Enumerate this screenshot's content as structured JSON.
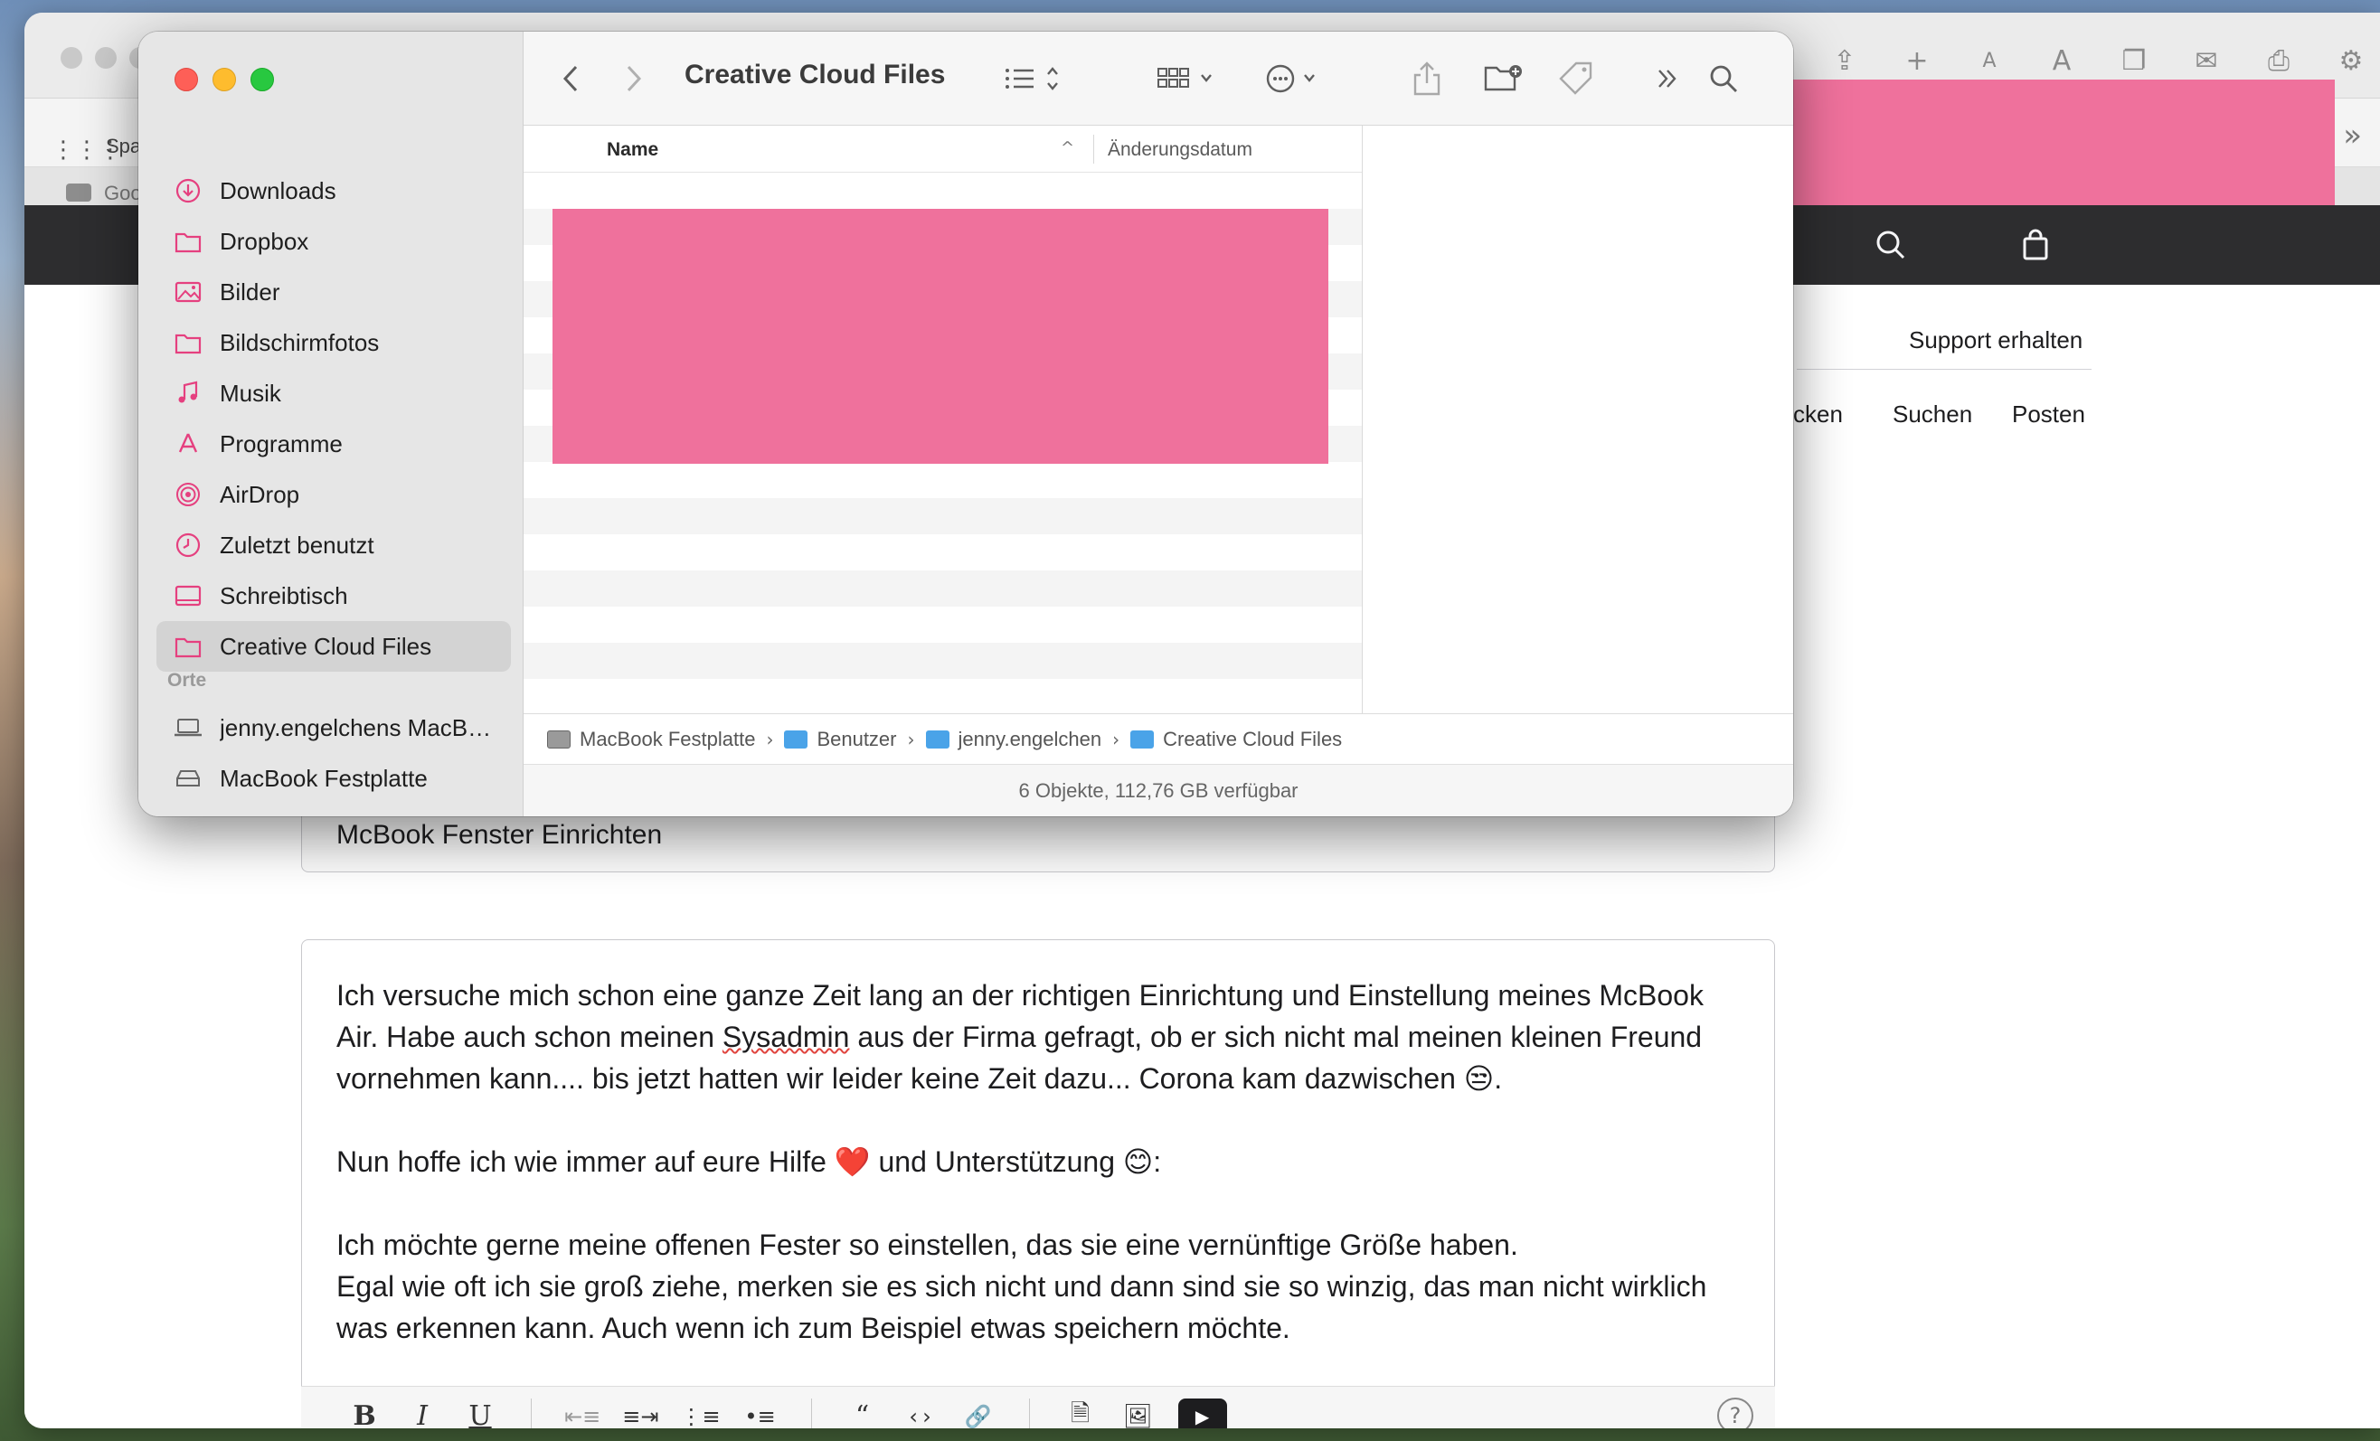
{
  "browser": {
    "favorites_label": "Spa",
    "tab_label": "Goo",
    "support_link": "Support erhalten",
    "sub_nav": [
      "cken",
      "Suchen",
      "Posten"
    ],
    "post_title": "McBook Fenster Einrichten",
    "post_body": {
      "p1": "Ich versuche mich schon eine ganze Zeit lang an der richtigen Einrichtung und Einstellung meines McBook Air. Habe auch schon meinen ",
      "p1_misspelled": "Sysadmin",
      "p1_rest": " aus der Firma gefragt, ob er sich nicht mal meinen kleinen Freund vornehmen kann.... bis jetzt hatten wir leider keine Zeit dazu... Corona kam dazwischen ",
      "p1_emoji": "😒",
      "p1_end": ".",
      "p2_a": "Nun hoffe ich wie immer auf eure Hilfe ",
      "p2_heart": "❤️",
      "p2_b": " und Unterstützung ",
      "p2_emoji": "😊",
      "p2_end": ":",
      "p3_line1": "Ich möchte gerne meine offenen Fester so einstellen, das sie eine vernünftige Größe haben.",
      "p3_line2": "Egal wie oft ich sie groß ziehe, merken sie es sich nicht und dann sind sie so winzig, das man nicht wirklich was erkennen kann. Auch wenn ich zum Beispiel etwas speichern möchte."
    },
    "editor_toolbar": [
      "B",
      "I",
      "U"
    ]
  },
  "finder": {
    "title": "Creative Cloud Files",
    "sidebar": {
      "favorites": [
        {
          "label": "Downloads",
          "icon": "download-icon"
        },
        {
          "label": "Dropbox",
          "icon": "folder-icon"
        },
        {
          "label": "Bilder",
          "icon": "photo-icon"
        },
        {
          "label": "Bildschirmfotos",
          "icon": "folder-icon"
        },
        {
          "label": "Musik",
          "icon": "music-icon"
        },
        {
          "label": "Programme",
          "icon": "apps-icon"
        },
        {
          "label": "AirDrop",
          "icon": "airdrop-icon"
        },
        {
          "label": "Zuletzt benutzt",
          "icon": "clock-icon"
        },
        {
          "label": "Schreibtisch",
          "icon": "desktop-icon"
        },
        {
          "label": "Creative Cloud Files",
          "icon": "folder-icon"
        }
      ],
      "locations_header": "Orte",
      "locations": [
        {
          "label": "jenny.engelchens MacBook Air",
          "icon": "laptop-icon"
        },
        {
          "label": "MacBook Festplatte",
          "icon": "drive-icon"
        }
      ]
    },
    "columns": {
      "name": "Name",
      "date": "Änderungsdatum"
    },
    "path": [
      "MacBook Festplatte",
      "Benutzer",
      "jenny.engelchen",
      "Creative Cloud Files"
    ],
    "status": "6 Objekte, 112,76 GB verfügbar",
    "colors": {
      "accent": "#e5407f",
      "redaction": "#ef719c",
      "close": "#fe5f57",
      "minimize": "#febc2e",
      "zoom": "#28c840"
    }
  }
}
